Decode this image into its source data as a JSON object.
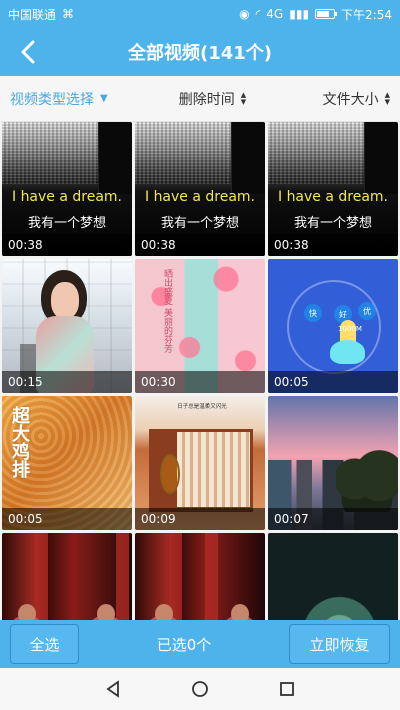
{
  "status": {
    "carrier": "中国联通",
    "usb_icon": "usb-icon",
    "network": "4G",
    "time": "下午2:54"
  },
  "header": {
    "title": "全部视频(141个)",
    "back_icon": "chevron-left-icon"
  },
  "filters": {
    "type_label": "视频类型选择",
    "time_label": "删除时间",
    "size_label": "文件大小",
    "active_color": "#4aa8e0"
  },
  "videos": [
    {
      "duration": "00:38",
      "title_en": "I have a dream.",
      "title_cn": "我有一个梦想"
    },
    {
      "duration": "00:38",
      "title_en": "I have a dream.",
      "title_cn": "我有一个梦想"
    },
    {
      "duration": "00:38",
      "title_en": "I have a dream.",
      "title_cn": "我有一个梦想"
    },
    {
      "duration": "00:15"
    },
    {
      "duration": "00:30",
      "vertical_text": "晒出盛夏 美丽的芬芳"
    },
    {
      "duration": "00:05",
      "chips": [
        "快",
        "好",
        "优"
      ],
      "labels": [
        "1000M"
      ]
    },
    {
      "duration": "00:05",
      "vertical_text": "超大鸡排"
    },
    {
      "duration": "00:09",
      "caption": "日子总是温柔又闪光"
    },
    {
      "duration": "00:07"
    },
    {
      "duration": ""
    },
    {
      "duration": ""
    },
    {
      "duration": ""
    }
  ],
  "footer": {
    "select_all_label": "全选",
    "selected_text": "已选0个",
    "restore_label": "立即恢复"
  },
  "colors": {
    "primary": "#4db3ea",
    "footer_button": "#56b8ef",
    "surface": "#f6f6f6"
  }
}
